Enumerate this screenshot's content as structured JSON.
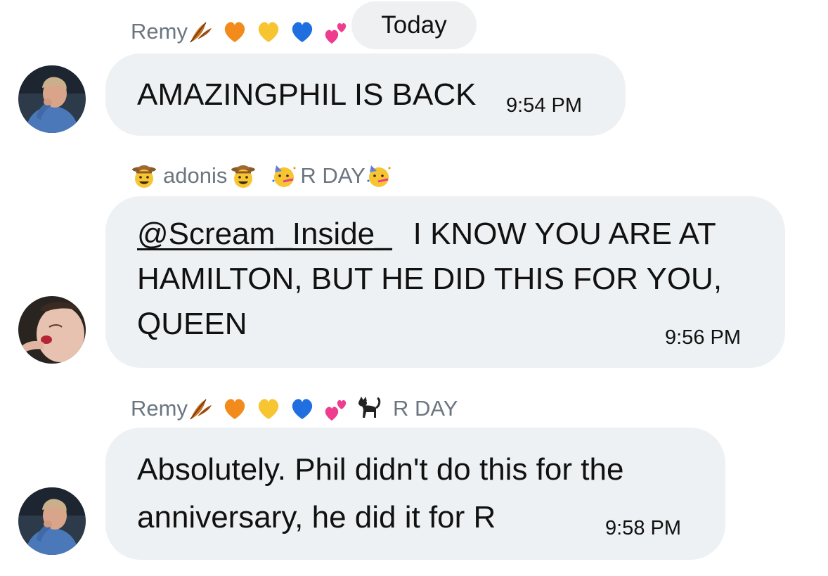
{
  "date_divider": "Today",
  "messages": [
    {
      "sender": "Remy",
      "sender_suffix": "",
      "text": "AMAZINGPHIL IS BACK",
      "time": "9:54 PM"
    },
    {
      "sender": "adonis",
      "sender_suffix": "R DAY",
      "mention": "@Scream_Inside_",
      "text_after_mention": "I KNOW YOU ARE AT",
      "text_line2": "HAMILTON, BUT HE DID THIS FOR YOU,",
      "text_line3": "QUEEN",
      "time": "9:56 PM"
    },
    {
      "sender": "Remy",
      "sender_suffix": "R DAY",
      "text_line1": "Absolutely. Phil didn't do this for the",
      "text_line2": "anniversary, he did it for R",
      "time": "9:58 PM"
    }
  ],
  "icons": {
    "remy_decorations": [
      "leaf-icon",
      "orange-heart-icon",
      "yellow-heart-icon",
      "blue-heart-icon",
      "two-hearts-icon"
    ],
    "remy_extra": "black-cat-icon",
    "adonis_decorations": [
      "cowboy-face-icon",
      "party-face-icon"
    ]
  },
  "colors": {
    "bubble": "#eef1f3",
    "sender_name": "#6b7680",
    "orange_heart": "#f28b1b",
    "yellow_heart": "#f7c531",
    "blue_heart": "#1f6fe0",
    "pink_heart": "#ee3c8e"
  }
}
